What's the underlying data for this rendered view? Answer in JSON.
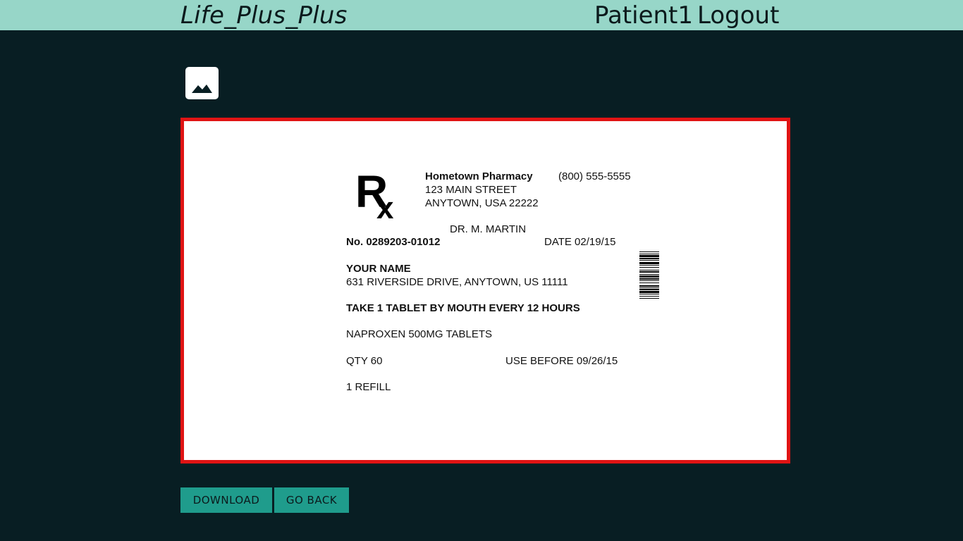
{
  "header": {
    "brand": "Life_Plus_Plus",
    "user": "Patient1",
    "logout": "Logout"
  },
  "toolbar": {
    "image_icon": "image-icon"
  },
  "label": {
    "logo": "Rx",
    "pharmacy_name": "Hometown Pharmacy",
    "phone": "(800) 555-5555",
    "street": "123 MAIN STREET",
    "city": "ANYTOWN, USA 22222",
    "doctor": "DR. M. MARTIN",
    "rx_number": "No. 0289203-01012",
    "date": "DATE 02/19/15",
    "patient_name": "YOUR NAME",
    "patient_address": "631 RIVERSIDE DRIVE, ANYTOWN, US 11111",
    "instructions": "TAKE 1 TABLET BY MOUTH EVERY 12 HOURS",
    "medication": "NAPROXEN 500MG TABLETS",
    "quantity": "QTY 60",
    "use_before": "USE BEFORE 09/26/15",
    "refills": "1 REFILL"
  },
  "actions": {
    "download": "DOWNLOAD",
    "go_back": "GO BACK"
  },
  "colors": {
    "topbar": "#97d6c8",
    "background": "#081e23",
    "frame_border": "#e01414",
    "button": "#1f9c8c"
  }
}
